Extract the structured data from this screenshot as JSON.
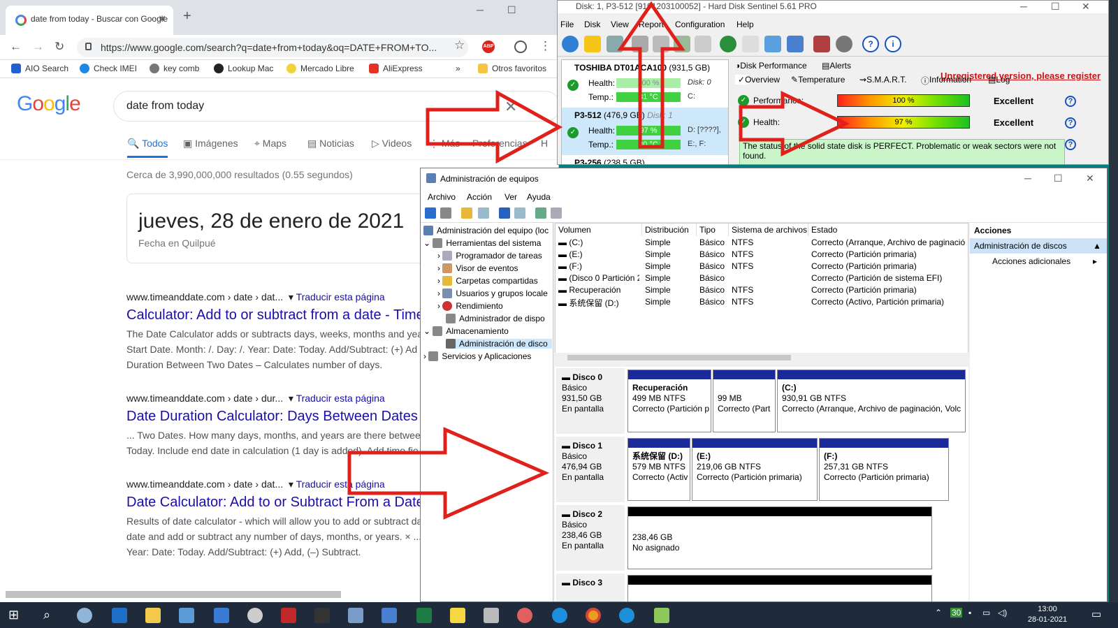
{
  "chrome": {
    "tab_title": "date from today - Buscar con Google",
    "url": "https://www.google.com/search?q=date+from+today&oq=DATE+FROM+TO...",
    "bookmarks": [
      "AIO Search",
      "Check IMEI",
      "key comb",
      "Lookup Mac",
      "Mercado Libre",
      "AliExpress"
    ],
    "bookmarks_more": "»",
    "other_bookmarks": "Otros favoritos"
  },
  "google": {
    "logo": "Google",
    "query": "date from today",
    "tabs": [
      "Todos",
      "Imágenes",
      "Maps",
      "Noticias",
      "Videos",
      "Más",
      "Preferencias",
      "H"
    ],
    "stats": "Cerca de 3,990,000,000 resultados (0.55 segundos)",
    "answer_date": "jueves, 28 de enero de 2021",
    "answer_location": "Fecha en Quilpué",
    "results": [
      {
        "url": "www.timeanddate.com › date › dat...",
        "translate": "Traducir esta página",
        "title": "Calculator: Add to or subtract from a date - Time",
        "snippet1": "The Date Calculator adds or subtracts days, weeks, months and yea",
        "snippet2": "Start Date. Month: /. Day: /. Year: Date: Today. Add/Subtract: (+) Ad",
        "snippet3": "Duration Between Two Dates – Calculates number of days."
      },
      {
        "url": "www.timeanddate.com › date › dur...",
        "translate": "Traducir esta página",
        "title": "Date Duration Calculator: Days Between Dates",
        "snippet1": "... Two Dates. How many days, months, and years are there betwee",
        "snippet2": "Today. Include end date in calculation (1 day is added). Add time fie",
        "snippet3": ""
      },
      {
        "url": "www.timeanddate.com › date › dat...",
        "translate": "Traducir esta página",
        "title": "Date Calculator: Add to or Subtract From a Date",
        "snippet1": "Results of date calculator - which will allow you to add or subtract da",
        "snippet2": "date and add or subtract any number of days, months, or years. × ...",
        "snippet3": "Year: Date: Today. Add/Subtract: (+) Add, (–) Subtract."
      }
    ]
  },
  "hds": {
    "title": "Disk: 1, P3-512 [9101203100052]  -  Hard Disk Sentinel 5.61 PRO",
    "menu": [
      "File",
      "Disk",
      "View",
      "Report",
      "Configuration",
      "Help"
    ],
    "unregistered": "Unregistered version, please register",
    "disks": [
      {
        "name": "TOSHIBA DT01ACA100",
        "size": "(931,5 GB)",
        "disk": "Disk: 0",
        "health_label": "Health:",
        "health": "100 %",
        "temp_label": "Temp.:",
        "temp": "31 °C",
        "drives1": "",
        "drives2": "C:"
      },
      {
        "name": "P3-512",
        "size": "(476,9 GB)",
        "disk": "Disk: 1",
        "health_label": "Health:",
        "health": "97 %",
        "temp_label": "Temp.:",
        "temp": "30 °C",
        "drives1": "D: [????],",
        "drives2": "E:, F:"
      },
      {
        "name": "P3-256",
        "size": "(238,5 GB)",
        "disk": "",
        "health_label": "",
        "health": "",
        "temp_label": "",
        "temp": "",
        "drives1": "",
        "drives2": ""
      }
    ],
    "tabs_row1": [
      "Disk Performance",
      "Alerts"
    ],
    "tabs_row2": [
      "Overview",
      "Temperature",
      "S.M.A.R.T.",
      "Information",
      "Log"
    ],
    "performance_label": "Performance:",
    "performance_value": "100 %",
    "performance_text": "Excellent",
    "health_label": "Health:",
    "health_value": "97 %",
    "health_text": "Excellent",
    "status": "The status of the solid state disk is PERFECT. Problematic or weak sectors were not found."
  },
  "dm": {
    "title": "Administración de equipos",
    "menu": [
      "Archivo",
      "Acción",
      "Ver",
      "Ayuda"
    ],
    "tree": [
      "Administración del equipo (loc",
      "Herramientas del sistema",
      "Programador de tareas",
      "Visor de eventos",
      "Carpetas compartidas",
      "Usuarios y grupos locale",
      "Rendimiento",
      "Administrador de dispo",
      "Almacenamiento",
      "Administración de disco",
      "Servicios y Aplicaciones"
    ],
    "columns": [
      "Volumen",
      "Distribución",
      "Tipo",
      "Sistema de archivos",
      "Estado"
    ],
    "volumes": [
      [
        "(C:)",
        "Simple",
        "Básico",
        "NTFS",
        "Correcto (Arranque, Archivo de paginació"
      ],
      [
        "(E:)",
        "Simple",
        "Básico",
        "NTFS",
        "Correcto (Partición primaria)"
      ],
      [
        "(F:)",
        "Simple",
        "Básico",
        "NTFS",
        "Correcto (Partición primaria)"
      ],
      [
        "(Disco 0 Partición 2)",
        "Simple",
        "Básico",
        "",
        "Correcto (Partición de sistema EFI)"
      ],
      [
        "Recuperación",
        "Simple",
        "Básico",
        "NTFS",
        "Correcto (Partición primaria)"
      ],
      [
        "系统保留 (D:)",
        "Simple",
        "Básico",
        "NTFS",
        "Correcto (Activo, Partición primaria)"
      ]
    ],
    "disks": [
      {
        "name": "Disco 0",
        "type": "Básico",
        "size": "931,50 GB",
        "state": "En pantalla",
        "parts": [
          {
            "l1": "Recuperación",
            "l2": "499 MB NTFS",
            "l3": "Correcto (Partición p"
          },
          {
            "l1": "",
            "l2": "99 MB",
            "l3": "Correcto (Part"
          },
          {
            "l1": "(C:)",
            "l2": "930,91 GB NTFS",
            "l3": "Correcto (Arranque, Archivo de paginación, Volc"
          }
        ]
      },
      {
        "name": "Disco 1",
        "type": "Básico",
        "size": "476,94 GB",
        "state": "En pantalla",
        "parts": [
          {
            "l1": "系统保留 (D:)",
            "l2": "579 MB NTFS",
            "l3": "Correcto (Activ"
          },
          {
            "l1": "(E:)",
            "l2": "219,06 GB NTFS",
            "l3": "Correcto (Partición primaria)"
          },
          {
            "l1": "(F:)",
            "l2": "257,31 GB NTFS",
            "l3": "Correcto (Partición primaria)"
          }
        ]
      },
      {
        "name": "Disco 2",
        "type": "Básico",
        "size": "238,46 GB",
        "state": "En pantalla",
        "parts": [
          {
            "l1": "",
            "l2": "238,46 GB",
            "l3": "No asignado"
          }
        ]
      },
      {
        "name": "Disco 3",
        "type": "",
        "size": "",
        "state": "",
        "parts": []
      }
    ],
    "actions_header": "Acciones",
    "actions_selected": "Administración de discos",
    "actions_more": "Acciones adicionales"
  },
  "taskbar": {
    "tray_badge": "30",
    "time": "13:00",
    "date": "28-01-2021"
  },
  "colors": {
    "arrow": "#e0201a",
    "google_blue": "#1a73e8",
    "link": "#1a0dab",
    "partition_primary": "#1a2b99",
    "unallocated": "#000000"
  }
}
